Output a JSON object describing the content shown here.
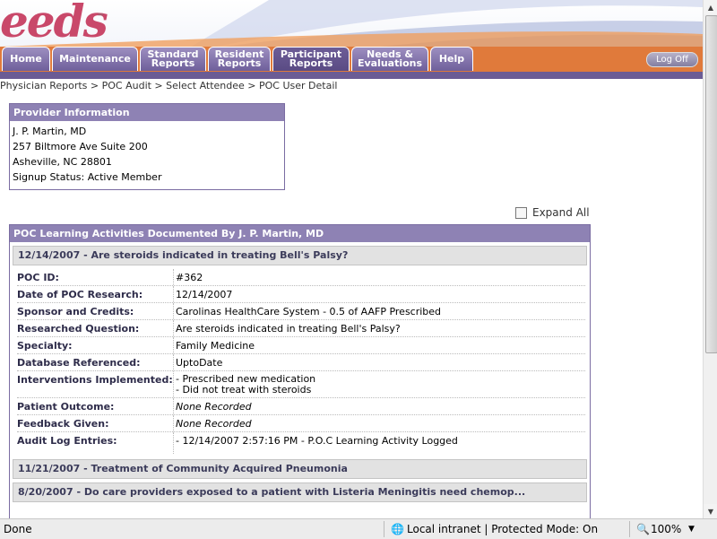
{
  "brand": {
    "logo_text": "eeds",
    "tm": "™"
  },
  "nav": {
    "tabs": [
      {
        "label": "Home"
      },
      {
        "label": "Maintenance"
      },
      {
        "label": "Standard Reports"
      },
      {
        "label": "Resident Reports"
      },
      {
        "label": "Participant Reports"
      },
      {
        "label": "Needs & Evaluations"
      },
      {
        "label": "Help"
      }
    ],
    "logoff": "Log Off"
  },
  "breadcrumb": "Physician Reports > POC Audit > Select Attendee > POC User Detail",
  "provider": {
    "heading": "Provider Information",
    "name": "J. P. Martin, MD",
    "address1": "257 Biltmore Ave Suite 200",
    "address2": "Asheville, NC 28801",
    "status": "Signup Status: Active Member"
  },
  "expand_all": "Expand All",
  "activities": {
    "heading": "POC Learning Activities Documented By J. P. Martin, MD",
    "items": [
      {
        "title": "12/14/2007 - Are steroids indicated in treating Bell's Palsy?"
      },
      {
        "title": "11/21/2007 - Treatment of Community Acquired Pneumonia"
      },
      {
        "title": "8/20/2007 - Do care providers exposed to a patient with Listeria Meningitis need chemop..."
      }
    ],
    "detail": {
      "poc_id": {
        "label": "POC ID:",
        "value": "#362"
      },
      "date": {
        "label": "Date of POC Research:",
        "value": "12/14/2007"
      },
      "sponsor": {
        "label": "Sponsor and Credits:",
        "value": "Carolinas HealthCare System - 0.5 of AAFP Prescribed"
      },
      "question": {
        "label": "Researched Question:",
        "value": "Are steroids indicated in treating Bell's Palsy?"
      },
      "specialty": {
        "label": "Specialty:",
        "value": "Family Medicine"
      },
      "database": {
        "label": "Database Referenced:",
        "value": "UptoDate"
      },
      "interventions": {
        "label": "Interventions Implemented:",
        "values": [
          "- Prescribed new medication",
          "- Did not treat with steroids"
        ]
      },
      "outcome": {
        "label": "Patient Outcome:",
        "value": "None Recorded"
      },
      "feedback": {
        "label": "Feedback Given:",
        "value": "None Recorded"
      },
      "audit": {
        "label": "Audit Log Entries:",
        "value": "- 12/14/2007 2:57:16 PM - P.O.C Learning Activity Logged"
      }
    }
  },
  "statusbar": {
    "left": "Done",
    "zone": "Local intranet | Protected Mode: On",
    "zoom": "100%"
  },
  "colors": {
    "accent": "#8e82b4",
    "tab": "#7a6ca2",
    "logo": "#c9486a"
  }
}
